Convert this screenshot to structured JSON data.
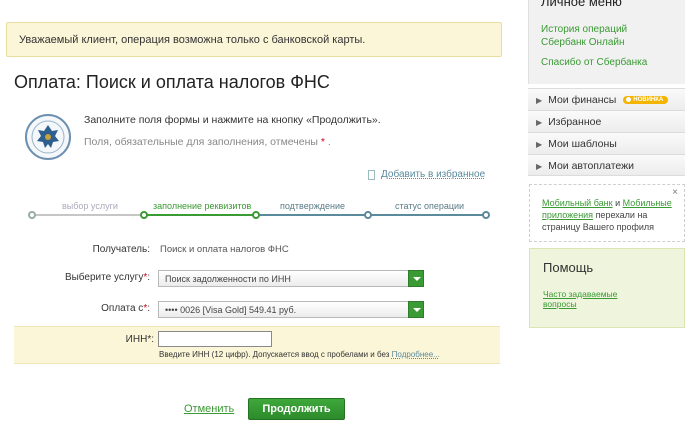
{
  "notice": {
    "text": "Уважаемый клиент, операция возможна только с банковской карты."
  },
  "page": {
    "title": "Оплата: Поиск и оплата налогов ФНС",
    "instruction": "Заполните поля формы и нажмите на кнопку «Продолжить».",
    "required_note": "Поля, обязательные для заполнения, отмечены",
    "required_mark": "*",
    "required_tail": ".",
    "favorite_label": "Добавить в избранное"
  },
  "steps": [
    {
      "label": "выбор услуги",
      "state": "done"
    },
    {
      "label": "заполнение реквизитов",
      "state": "active"
    },
    {
      "label": "подтверждение",
      "state": "pending"
    },
    {
      "label": "статус операции",
      "state": "pending"
    }
  ],
  "form": {
    "recipient_label": "Получатель:",
    "recipient_value": "Поиск и оплата налогов ФНС",
    "service_label": "Выберите услугу",
    "service_value": "Поиск задолженности по ИНН",
    "payfrom_label": "Оплата с",
    "payfrom_value": "•••• 0026 [Visa Gold] 549.41 руб.",
    "inn_label": "ИНН",
    "inn_value": "",
    "inn_hint": "Введите ИНН (12 цифр). Допускается ввод с пробелами и без",
    "inn_more": "Подробнее...",
    "req": "*",
    "colon": ":"
  },
  "actions": {
    "cancel": "Отменить",
    "continue": "Продолжить"
  },
  "sidebar": {
    "title": "Личное меню",
    "links": [
      "История операций",
      "Сбербанк Онлайн",
      "Спасибо от Сбербанка"
    ],
    "menu": [
      {
        "label": "Мои финансы",
        "badge": "НОВИНКА"
      },
      {
        "label": "Избранное"
      },
      {
        "label": "Мои шаблоны"
      },
      {
        "label": "Мои автоплатежи"
      }
    ],
    "moved": {
      "link1": "Мобильный банк",
      "and": " и ",
      "link2": "Мобильные приложения",
      "text": " перехали на страницу Вашего профиля",
      "close": "×"
    },
    "help": {
      "title": "Помощь",
      "faq": "Часто задаваемые вопросы"
    }
  },
  "colors": {
    "accent": "#3a9a34",
    "notice_bg": "#fbf6d8",
    "required": "#d0021b",
    "link_blue": "#5a8a9c"
  }
}
